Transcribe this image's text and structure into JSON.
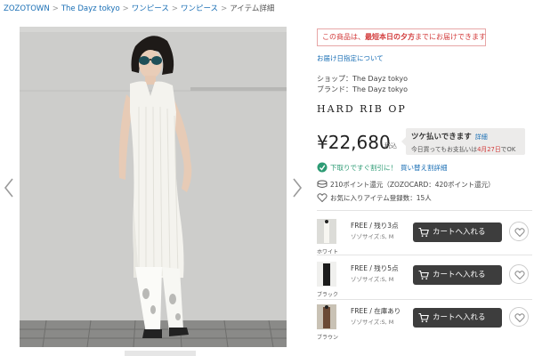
{
  "breadcrumb": {
    "items": [
      "ZOZOTOWN",
      "The Dayz tokyo",
      "ワンピース",
      "ワンピース",
      "アイテム詳細"
    ],
    "separator": ">"
  },
  "notice": {
    "prefix": "この商品は、",
    "emphasis": "最短本日の夕方",
    "suffix": "までにお届けできます"
  },
  "delivery_link": "お届け日指定について",
  "shop": {
    "label": "ショップ：",
    "name": "The Dayz tokyo"
  },
  "brand": {
    "label": "ブランド：",
    "name": "The Dayz tokyo"
  },
  "product_title": "HARD RIB OP",
  "price": {
    "amount": "¥22,680",
    "tax_label": "税込"
  },
  "tsuke": {
    "title": "ツケ払いできます",
    "detail_link": "詳細",
    "sub_prefix": "今日買っても",
    "sub_mid": "お支払いは",
    "sub_date": "4月27日",
    "sub_suffix": "でOK"
  },
  "sale_notice": {
    "text": "下取りですぐ割引に！",
    "link": "買い替え割詳細"
  },
  "points": "210ポイント還元（ZOZOCARD：420ポイント還元）",
  "favorites": "お気に入りアイテム登録数：15人",
  "skus": [
    {
      "color": "ホワイト",
      "size_stock": "FREE / 残り3点",
      "sizes": "ゾゾサイズ:S, M",
      "cart_label": "カートへ入れる"
    },
    {
      "color": "ブラック",
      "size_stock": "FREE / 残り5点",
      "sizes": "ゾゾサイズ:S, M",
      "cart_label": "カートへ入れる"
    },
    {
      "color": "ブラウン",
      "size_stock": "FREE / 在庫あり",
      "sizes": "ゾゾサイズ:S, M",
      "cart_label": "カートへ入れる"
    }
  ],
  "colors": {
    "link": "#1a6fb5",
    "alert_red": "#d23a3a",
    "green": "#2d9b74",
    "cart_button": "#3d3d3d"
  },
  "icons": {
    "prev": "chevron-left-icon",
    "next": "chevron-right-icon",
    "sale": "tag-icon",
    "points": "coin-icon",
    "favorite": "heart-icon",
    "cart": "cart-icon"
  }
}
